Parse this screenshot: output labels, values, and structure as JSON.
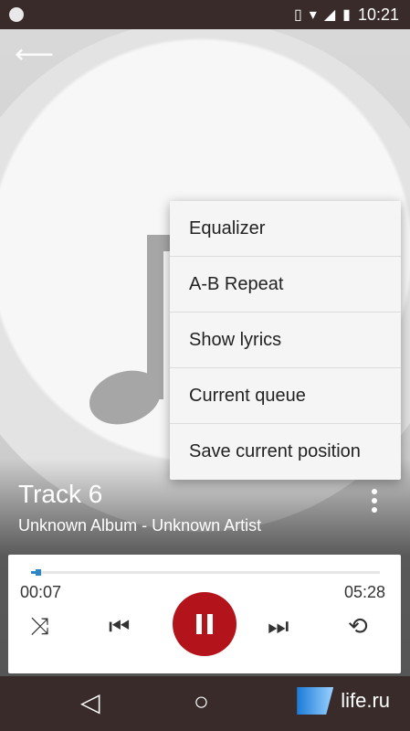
{
  "status": {
    "time": "10:21"
  },
  "menu": {
    "items": [
      {
        "label": "Equalizer"
      },
      {
        "label": "A-B Repeat"
      },
      {
        "label": "Show lyrics"
      },
      {
        "label": "Current queue"
      },
      {
        "label": "Save current position"
      }
    ]
  },
  "track": {
    "title": "Track 6",
    "subtitle": "Unknown Album - Unknown Artist"
  },
  "player": {
    "elapsed": "00:07",
    "duration": "05:28",
    "progress_fraction": 0.022
  },
  "watermark": {
    "text": "life.ru"
  },
  "colors": {
    "accent": "#b3141b",
    "progress": "#2f86c6",
    "bars": "#3a2b2b"
  },
  "icons": [
    "back-arrow-icon",
    "shuffle-icon",
    "previous-icon",
    "pause-icon",
    "next-icon",
    "repeat-icon",
    "back-icon",
    "home-icon",
    "recents-icon",
    "more-vert-icon"
  ]
}
